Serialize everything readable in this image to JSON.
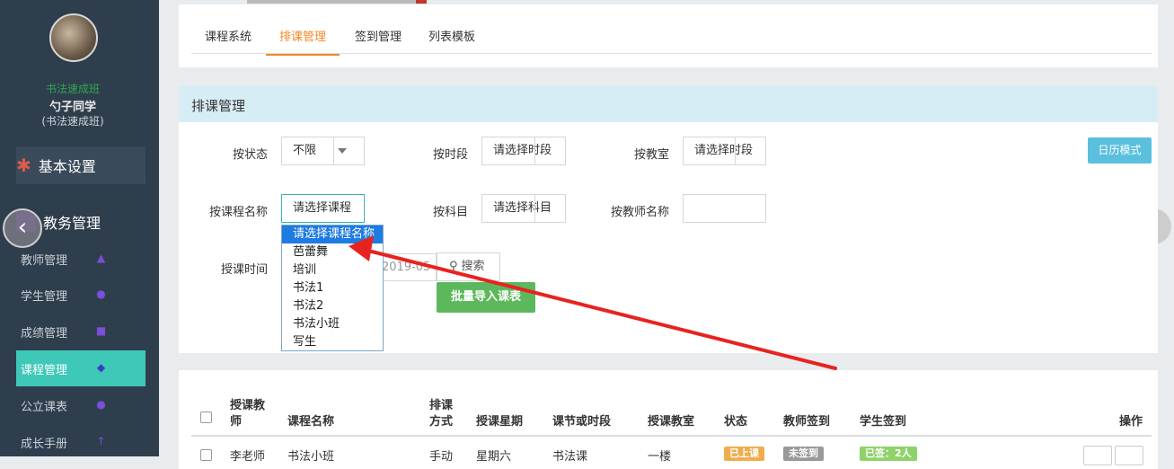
{
  "sidebar": {
    "class_name": "书法速成班",
    "user_name": "勺子同学",
    "user_class": "(书法速成班)",
    "basic_settings": "基本设置",
    "edu_mgmt": "教务管理",
    "items": [
      {
        "label": "教师管理",
        "icon": "user-icon"
      },
      {
        "label": "学生管理",
        "icon": "users-icon"
      },
      {
        "label": "成绩管理",
        "icon": "book-icon"
      },
      {
        "label": "课程管理",
        "icon": "graduation-cap-icon"
      },
      {
        "label": "公立课表",
        "icon": "apple-icon"
      },
      {
        "label": "成长手册",
        "icon": "arrow-up-icon"
      }
    ]
  },
  "tabs": [
    "课程系统",
    "排课管理",
    "签到管理",
    "列表模板"
  ],
  "filter": {
    "title": "排课管理",
    "status_label": "按状态",
    "status_value": "不限",
    "period_label": "按时段",
    "period_value": "请选择时段",
    "room_label": "按教室",
    "room_value": "请选择时段",
    "course_label": "按课程名称",
    "course_value": "请选择课程",
    "subject_label": "按科目",
    "subject_value": "请选择科目",
    "teacher_label": "按教师名称",
    "teacher_value": "",
    "time_label": "授课时间",
    "date_value": "2019-05",
    "search": "搜索",
    "import": "批量导入课表",
    "calendar": "日历模式"
  },
  "dropdown": {
    "options": [
      "请选择课程名称",
      "芭蕾舞",
      "培训",
      "书法1",
      "书法2",
      "书法小班",
      "写生"
    ],
    "selected_index": 0
  },
  "table": {
    "headers": {
      "teacher_line1": "授课教",
      "teacher_line2": "师",
      "course": "课程名称",
      "mode_line1": "排课",
      "mode_line2": "方式",
      "weekday": "授课星期",
      "period": "课节或时段",
      "room": "授课教室",
      "status": "状态",
      "teacher_signin": "教师签到",
      "student_signin": "学生签到",
      "action": "操作"
    },
    "row": {
      "teacher": "李老师",
      "course": "书法小班",
      "mode": "手动",
      "weekday": "星期六",
      "period": "书法课",
      "room": "一楼",
      "status": "已上课",
      "teacher_signin": "未签到",
      "student_signin": "已签：2人"
    }
  },
  "colors": {
    "accent_tab": "#f08a2a",
    "sidebar_active": "#3ec8b8",
    "arrow": "#e8231f"
  }
}
